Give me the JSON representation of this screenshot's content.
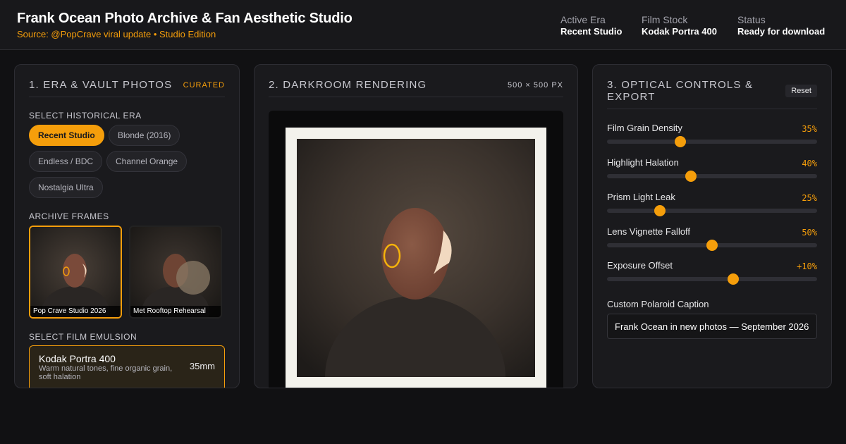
{
  "header": {
    "title": "Frank Ocean Photo Archive & Fan Aesthetic Studio",
    "subtitle": "Source: @PopCrave viral update • Studio Edition",
    "meta": [
      {
        "label": "Active Era",
        "value": "Recent Studio"
      },
      {
        "label": "Film Stock",
        "value": "Kodak Portra 400"
      },
      {
        "label": "Status",
        "value": "Ready for download"
      }
    ]
  },
  "left_panel": {
    "title": "1. Era & Vault Photos",
    "badge": "Curated",
    "era_label": "Select Historical Era",
    "eras": [
      {
        "label": "Recent Studio",
        "active": true
      },
      {
        "label": "Blonde (2016)",
        "active": false
      },
      {
        "label": "Endless / BDC",
        "active": false
      },
      {
        "label": "Channel Orange",
        "active": false
      },
      {
        "label": "Nostalgia Ultra",
        "active": false
      }
    ],
    "frames_label": "Archive Frames",
    "frames": [
      {
        "caption": "Pop Crave Studio 2026",
        "active": true
      },
      {
        "caption": "Met Rooftop Rehearsal",
        "active": false
      }
    ],
    "emulsion_label": "Select Film Emulsion",
    "emulsion": {
      "name": "Kodak Portra 400",
      "description": "Warm natural tones, fine organic grain, soft halation",
      "format": "35mm"
    }
  },
  "center_panel": {
    "title": "2. Darkroom Rendering",
    "dimensions": "500 × 500 PX"
  },
  "right_panel": {
    "title": "3. Optical Controls & Export",
    "reset_label": "Reset",
    "controls": [
      {
        "label": "Film Grain Density",
        "display": "35%",
        "level": 0.35
      },
      {
        "label": "Highlight Halation",
        "display": "40%",
        "level": 0.4
      },
      {
        "label": "Prism Light Leak",
        "display": "25%",
        "level": 0.25
      },
      {
        "label": "Lens Vignette Falloff",
        "display": "50%",
        "level": 0.5
      },
      {
        "label": "Exposure Offset",
        "display": "+10%",
        "level": 0.6
      }
    ],
    "caption_label": "Custom Polaroid Caption",
    "caption_value": "Frank Ocean in new photos — September 2026"
  },
  "colors": {
    "accent": "#f59e0b",
    "background": "#111113",
    "panel": "#1a1a1d"
  }
}
